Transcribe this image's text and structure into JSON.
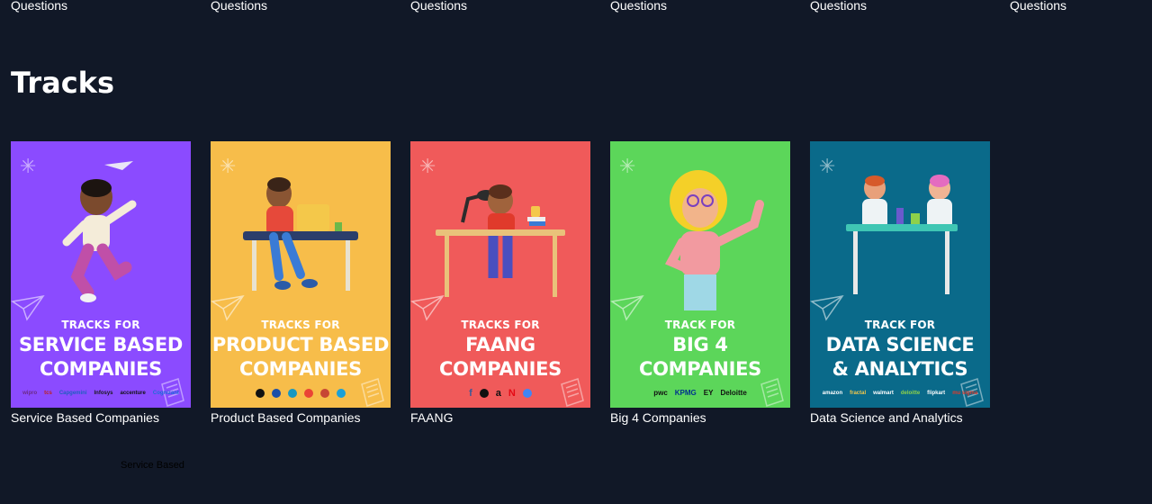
{
  "top_row": {
    "labels": [
      "Questions",
      "Questions",
      "Questions",
      "Questions",
      "Questions",
      "Questions"
    ]
  },
  "section": {
    "title": "Tracks"
  },
  "tracks": [
    {
      "title": "Service Based Companies",
      "poster": {
        "line1": "TRACKS FOR",
        "line2": "SERVICE BASED",
        "line3": "COMPANIES",
        "bg": "#8b4bff",
        "logos": [
          "wipro",
          "tcs",
          "Capgemini",
          "Infosys",
          "accenture",
          "Cognizant"
        ]
      }
    },
    {
      "title": "Product Based Companies",
      "poster": {
        "line1": "TRACKS FOR",
        "line2": "PRODUCT BASED",
        "line3": "COMPANIES",
        "bg": "#f7bd4a",
        "logos": [
          "apple",
          "samsung",
          "salesforce",
          "google",
          "oracle",
          "cisco"
        ]
      }
    },
    {
      "title": "FAANG",
      "poster": {
        "line1": "TRACKS FOR",
        "line2": "FAANG",
        "line3": "COMPANIES",
        "bg": "#f05a5a",
        "logos": [
          "facebook",
          "apple",
          "amazon",
          "netflix",
          "google"
        ]
      }
    },
    {
      "title": "Big 4 Companies",
      "poster": {
        "line1": "TRACK FOR",
        "line2": "BIG 4",
        "line3": "COMPANIES",
        "bg": "#5cd65a",
        "logos": [
          "pwc",
          "KPMG",
          "EY",
          "Deloitte"
        ]
      }
    },
    {
      "title": "Data Science and Analytics",
      "poster": {
        "line1": "TRACK FOR",
        "line2": "DATA SCIENCE",
        "line3": "& ANALYTICS",
        "bg": "#0a6a8a",
        "logos": [
          "amazon",
          "fractal",
          "walmart",
          "deloitte",
          "flipkart",
          "mu sigma"
        ]
      }
    }
  ],
  "broken_image_alt": "Service Based"
}
